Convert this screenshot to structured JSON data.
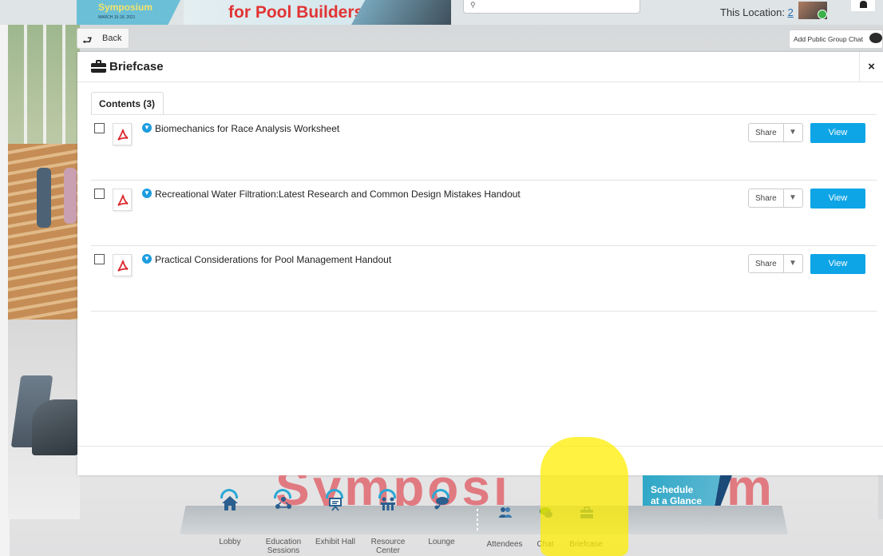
{
  "banner": {
    "logo_title": "Symposium",
    "logo_dates": "MARCH 15-18, 2021",
    "headline": "for Pool Builders",
    "location_label": "This Location:",
    "location_count": "2"
  },
  "toolbar": {
    "back_label": "Back",
    "add_chat_label": "Add Public Group Chat"
  },
  "briefcase": {
    "title": "Briefcase",
    "close_label": "×",
    "tab_label": "Contents (3)",
    "share_label": "Share",
    "view_label": "View",
    "items": [
      {
        "title": "Biomechanics for Race Analysis Worksheet"
      },
      {
        "title": "Recreational Water Filtration:Latest Research and Common Design Mistakes Handout"
      },
      {
        "title": "Practical Considerations for Pool Management Handout"
      }
    ]
  },
  "schedule": {
    "line1": "Schedule",
    "line2": "at a Glance"
  },
  "nav": {
    "items": [
      {
        "label": "Lobby",
        "icon": "home-icon"
      },
      {
        "label": "Education Sessions",
        "icon": "education-icon"
      },
      {
        "label": "Exhibit Hall",
        "icon": "exhibit-icon"
      },
      {
        "label": "Resource Center",
        "icon": "resource-icon"
      },
      {
        "label": "Lounge",
        "icon": "lounge-icon"
      },
      {
        "label": "Attendees",
        "icon": "attendees-icon"
      },
      {
        "label": "Chat",
        "icon": "chat-icon"
      },
      {
        "label": "Briefcase",
        "icon": "briefcase-icon"
      }
    ]
  },
  "colors": {
    "accent": "#0ea5e6",
    "pdf_red": "#d9262b",
    "nav_blue": "#2a5f8f",
    "highlight": "#ffee00"
  }
}
